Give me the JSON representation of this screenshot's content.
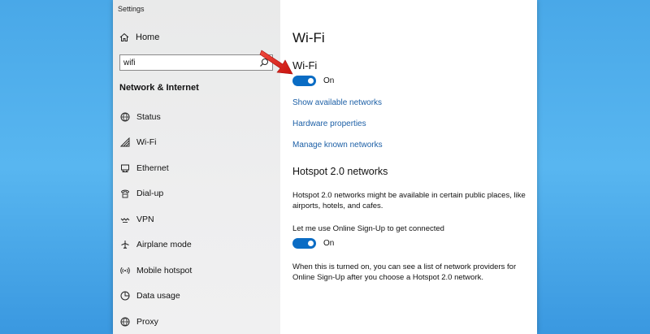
{
  "window": {
    "title": "Settings"
  },
  "sidebar": {
    "home_label": "Home",
    "search_value": "wifi",
    "section_title": "Network & Internet",
    "items": [
      {
        "label": "Status",
        "icon": "globe-icon"
      },
      {
        "label": "Wi-Fi",
        "icon": "wifi-icon"
      },
      {
        "label": "Ethernet",
        "icon": "ethernet-icon"
      },
      {
        "label": "Dial-up",
        "icon": "dialup-icon"
      },
      {
        "label": "VPN",
        "icon": "vpn-icon"
      },
      {
        "label": "Airplane mode",
        "icon": "airplane-icon"
      },
      {
        "label": "Mobile hotspot",
        "icon": "hotspot-icon"
      },
      {
        "label": "Data usage",
        "icon": "data-usage-icon"
      },
      {
        "label": "Proxy",
        "icon": "proxy-globe-icon"
      }
    ]
  },
  "main": {
    "page_title": "Wi-Fi",
    "wifi_heading": "Wi-Fi",
    "wifi_toggle_label": "On",
    "links": {
      "show_networks": "Show available networks",
      "hardware": "Hardware properties",
      "known_networks": "Manage known networks"
    },
    "hotspot_heading": "Hotspot 2.0 networks",
    "hotspot_desc": "Hotspot 2.0 networks might be available in certain public places, like airports, hotels, and cafes.",
    "signup_label": "Let me use Online Sign-Up to get connected",
    "signup_toggle_label": "On",
    "signup_desc": "When this is turned on, you can see a list of network providers for Online Sign-Up after you choose a Hotspot 2.0 network."
  },
  "colors": {
    "accent": "#0a6cc4",
    "link": "#1c5fa6",
    "annotation_arrow": "#e0211c",
    "desktop": "#49a8e8"
  }
}
